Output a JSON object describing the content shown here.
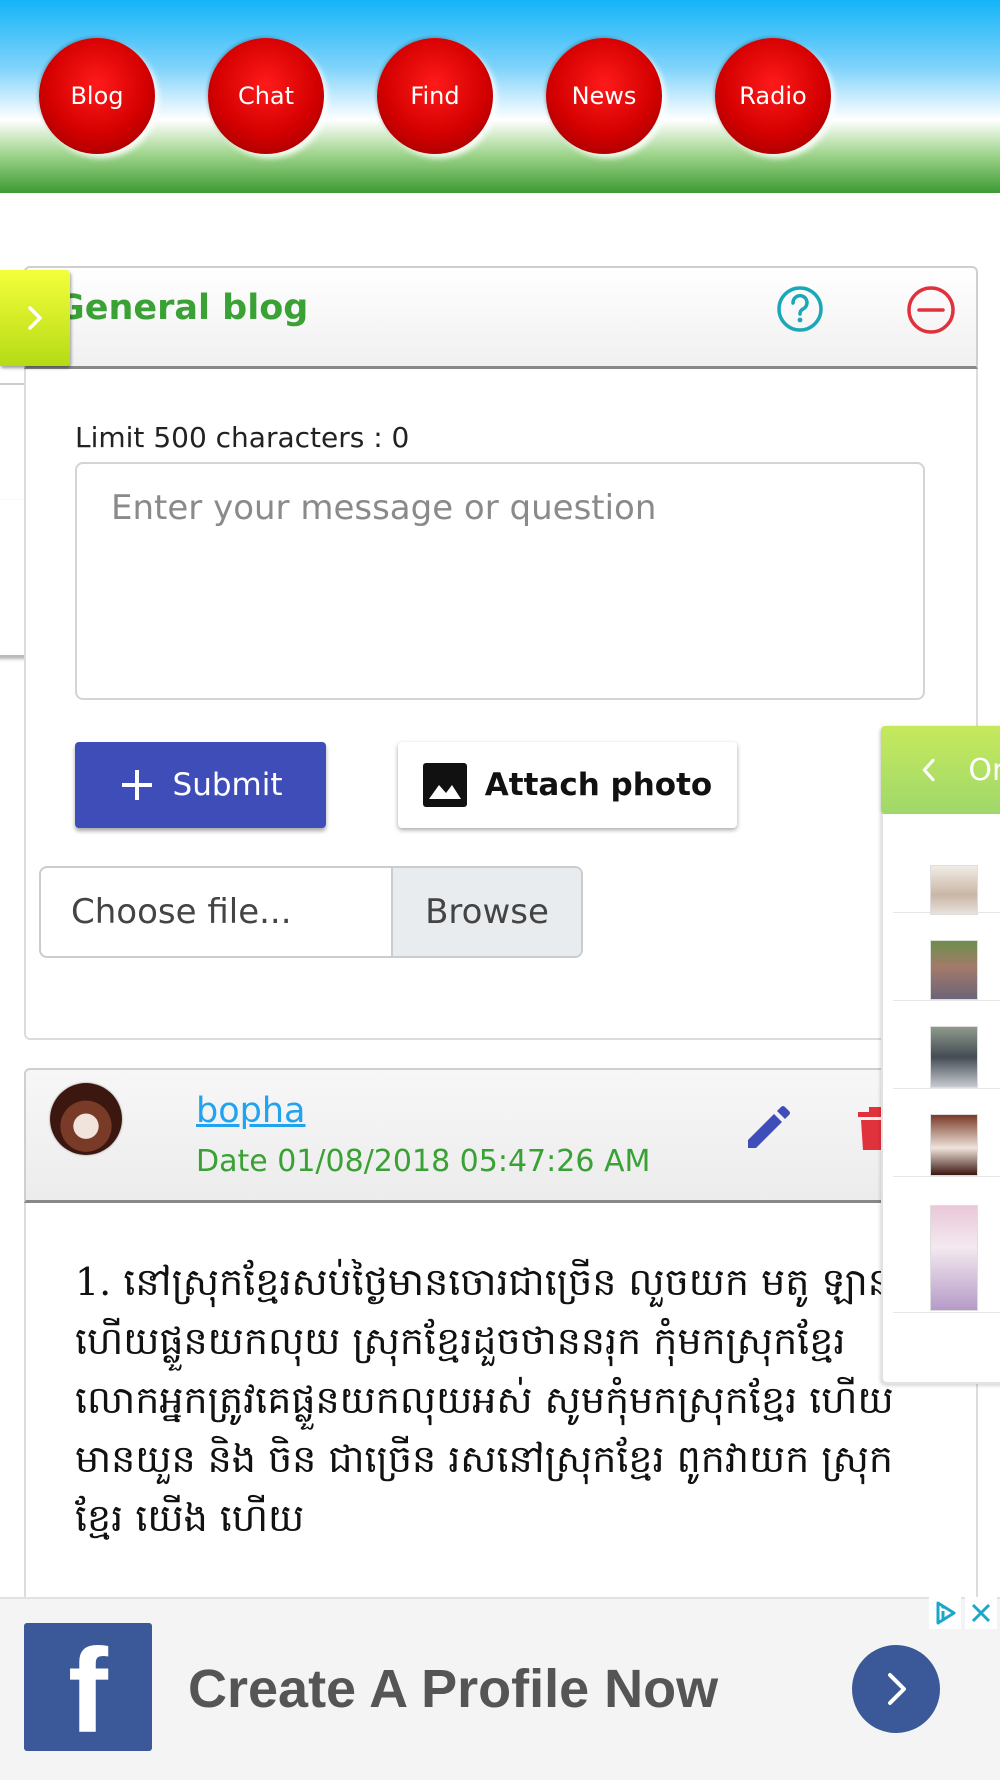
{
  "nav": {
    "items": [
      {
        "label": "Blog"
      },
      {
        "label": "Chat"
      },
      {
        "label": "Find"
      },
      {
        "label": "News"
      },
      {
        "label": "Radio"
      }
    ]
  },
  "blog_panel": {
    "title": "General blog",
    "help_icon": "help-circle-icon",
    "close_icon": "minus-circle-icon",
    "expand_icon": "chevron-right-icon",
    "limit_label": "Limit 500 characters : 0",
    "message_placeholder": "Enter your message or question",
    "message_value": "",
    "submit_label": "Submit",
    "attach_label": "Attach photo",
    "file_label": "Choose file...",
    "browse_label": "Browse"
  },
  "post": {
    "user": "bopha",
    "date": "Date 01/08/2018 05:47:26 AM",
    "body": "1. នៅស្រុកខ្មែរសប់ថ្ងៃមានចោរជាច្រើន លួចយក មតូ ឡាន ហើយផ្លួនយកលុយ ស្រុកខ្មែរដួចថាននរុក កុំមកស្រុកខ្មែរ លោកអ្នកត្រូវគេផ្លួនយកលុយអស់ សូមកុំមកស្រុកខ្មែរ ហើយមានយួន និង ចិន ជាច្រើន រសនៅស្រុកខ្មែរ ពូកវាយក ស្រុកខ្មែរ យើង ហើយ",
    "edit_icon": "pencil-icon",
    "delete_icon": "trash-icon"
  },
  "online_drawer": {
    "tab_label": "On",
    "tab_icon": "chevron-left-icon"
  },
  "ad": {
    "headline": "Create A Profile Now",
    "logo_letter": "f",
    "brand_color": "#3b5998"
  },
  "colors": {
    "accent_green": "#3aa135",
    "submit_blue": "#3f4db8",
    "link_blue": "#21a3ef",
    "nav_red": "#d40000"
  }
}
